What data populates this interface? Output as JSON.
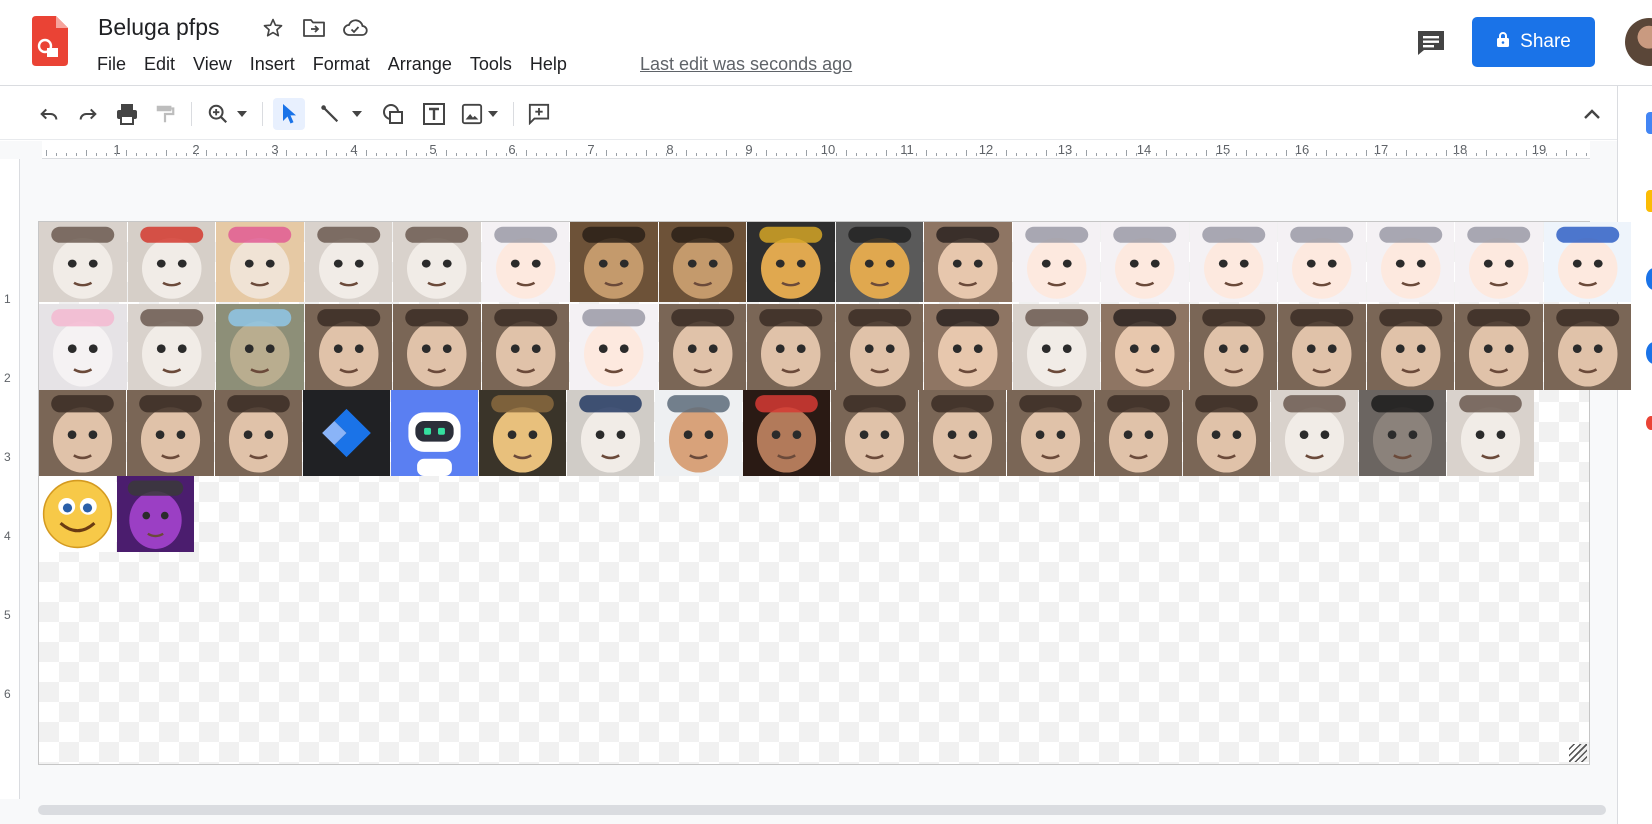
{
  "document": {
    "title": "Beluga pfps",
    "last_edit": "Last edit was seconds ago"
  },
  "menu": [
    "File",
    "Edit",
    "View",
    "Insert",
    "Format",
    "Arrange",
    "Tools",
    "Help"
  ],
  "share_button": {
    "label": "Share"
  },
  "toolbar": {
    "buttons": [
      "undo-icon",
      "redo-icon",
      "print-icon",
      "paint-format-icon",
      "zoom-icon",
      "select-icon",
      "line-icon",
      "shape-icon",
      "text-box-icon",
      "image-icon",
      "add-comment-icon"
    ],
    "collapse": "chevron-up-icon"
  },
  "ruler": {
    "horizontal": [
      "1",
      "2",
      "3",
      "4",
      "5",
      "6",
      "7",
      "8",
      "9",
      "10",
      "11",
      "12",
      "13",
      "14",
      "15",
      "16",
      "17",
      "18",
      "19"
    ],
    "vertical": [
      "1",
      "2",
      "3",
      "4",
      "5",
      "6"
    ]
  },
  "colors": {
    "accent": "#1a73e8",
    "logo": "#ea4335"
  },
  "slide": {
    "pictures": [
      [
        "cat",
        "cat-red-cap",
        "cat-pink-glasses",
        "cat-pipe",
        "cat-glasses",
        "anime-girl",
        "caracal",
        "caracal",
        "doge-helmet",
        "doge-hat",
        "woman-sunglasses",
        "anime-girl",
        "anime-girl",
        "anime-girl",
        "anime-girl",
        "anime-cat-girl",
        "anime-cat-girl",
        "anime-girl-blue"
      ],
      [
        "cat-pink-hat",
        "cat",
        "cat-mask",
        "man-beard",
        "man-glasses",
        "man-hat",
        "anime-cat-girl",
        "face",
        "man-glasses",
        "man-bald",
        "woman",
        "cat",
        "woman-glasses",
        "man-suit",
        "man-glasses",
        "man",
        "man-mustache",
        "man"
      ],
      [
        "man",
        "man",
        "man-hoodie",
        "app-logo-blue",
        "robot-app-icon",
        "cartoon-prince",
        "cat-police-hat",
        "fortnite-character",
        "man-bandana",
        "person-sunglasses",
        "man-black-shirt",
        "rick-astley",
        "elon-musk",
        "barack-obama",
        "cat",
        "cat-beanie",
        "cat"
      ],
      [
        "smiley-emoji",
        "purple-character"
      ]
    ]
  }
}
